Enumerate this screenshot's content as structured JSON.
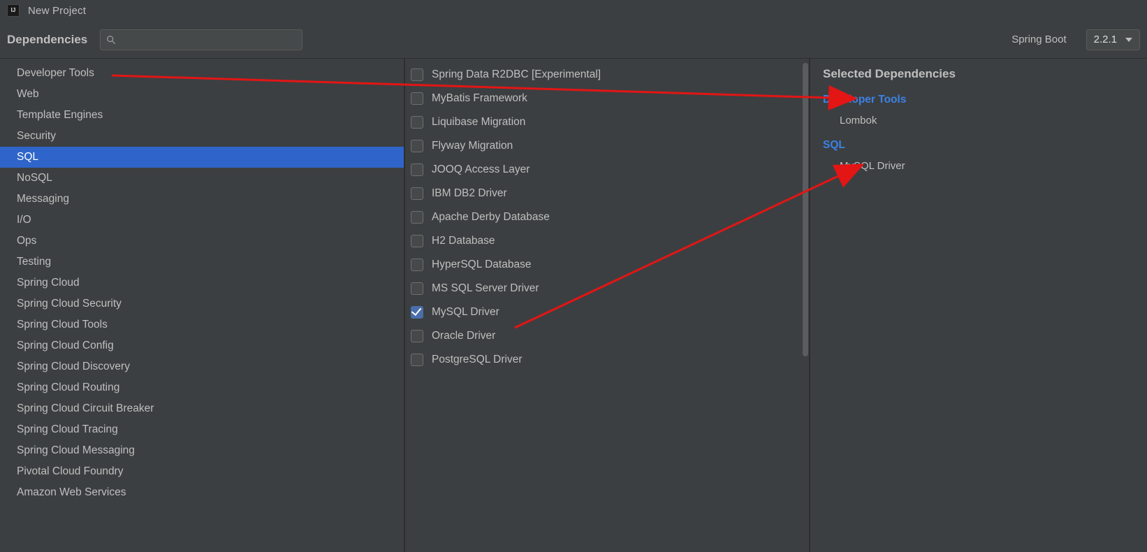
{
  "window": {
    "title": "New Project"
  },
  "toolbar": {
    "title": "Dependencies",
    "search_placeholder": "",
    "spring_boot_label": "Spring Boot",
    "spring_boot_version": "2.2.1"
  },
  "categories": [
    {
      "label": "Developer Tools",
      "selected": false
    },
    {
      "label": "Web",
      "selected": false
    },
    {
      "label": "Template Engines",
      "selected": false
    },
    {
      "label": "Security",
      "selected": false
    },
    {
      "label": "SQL",
      "selected": true
    },
    {
      "label": "NoSQL",
      "selected": false
    },
    {
      "label": "Messaging",
      "selected": false
    },
    {
      "label": "I/O",
      "selected": false
    },
    {
      "label": "Ops",
      "selected": false
    },
    {
      "label": "Testing",
      "selected": false
    },
    {
      "label": "Spring Cloud",
      "selected": false
    },
    {
      "label": "Spring Cloud Security",
      "selected": false
    },
    {
      "label": "Spring Cloud Tools",
      "selected": false
    },
    {
      "label": "Spring Cloud Config",
      "selected": false
    },
    {
      "label": "Spring Cloud Discovery",
      "selected": false
    },
    {
      "label": "Spring Cloud Routing",
      "selected": false
    },
    {
      "label": "Spring Cloud Circuit Breaker",
      "selected": false
    },
    {
      "label": "Spring Cloud Tracing",
      "selected": false
    },
    {
      "label": "Spring Cloud Messaging",
      "selected": false
    },
    {
      "label": "Pivotal Cloud Foundry",
      "selected": false
    },
    {
      "label": "Amazon Web Services",
      "selected": false
    }
  ],
  "dependencies": [
    {
      "label": "Spring Data R2DBC [Experimental]",
      "checked": false
    },
    {
      "label": "MyBatis Framework",
      "checked": false
    },
    {
      "label": "Liquibase Migration",
      "checked": false
    },
    {
      "label": "Flyway Migration",
      "checked": false
    },
    {
      "label": "JOOQ Access Layer",
      "checked": false
    },
    {
      "label": "IBM DB2 Driver",
      "checked": false
    },
    {
      "label": "Apache Derby Database",
      "checked": false
    },
    {
      "label": "H2 Database",
      "checked": false
    },
    {
      "label": "HyperSQL Database",
      "checked": false
    },
    {
      "label": "MS SQL Server Driver",
      "checked": false
    },
    {
      "label": "MySQL Driver",
      "checked": true
    },
    {
      "label": "Oracle Driver",
      "checked": false
    },
    {
      "label": "PostgreSQL Driver",
      "checked": false
    }
  ],
  "right": {
    "header": "Selected Dependencies",
    "groups": [
      {
        "title": "Developer Tools",
        "items": [
          "Lombok"
        ]
      },
      {
        "title": "SQL",
        "items": [
          "MySQL Driver"
        ]
      }
    ]
  }
}
